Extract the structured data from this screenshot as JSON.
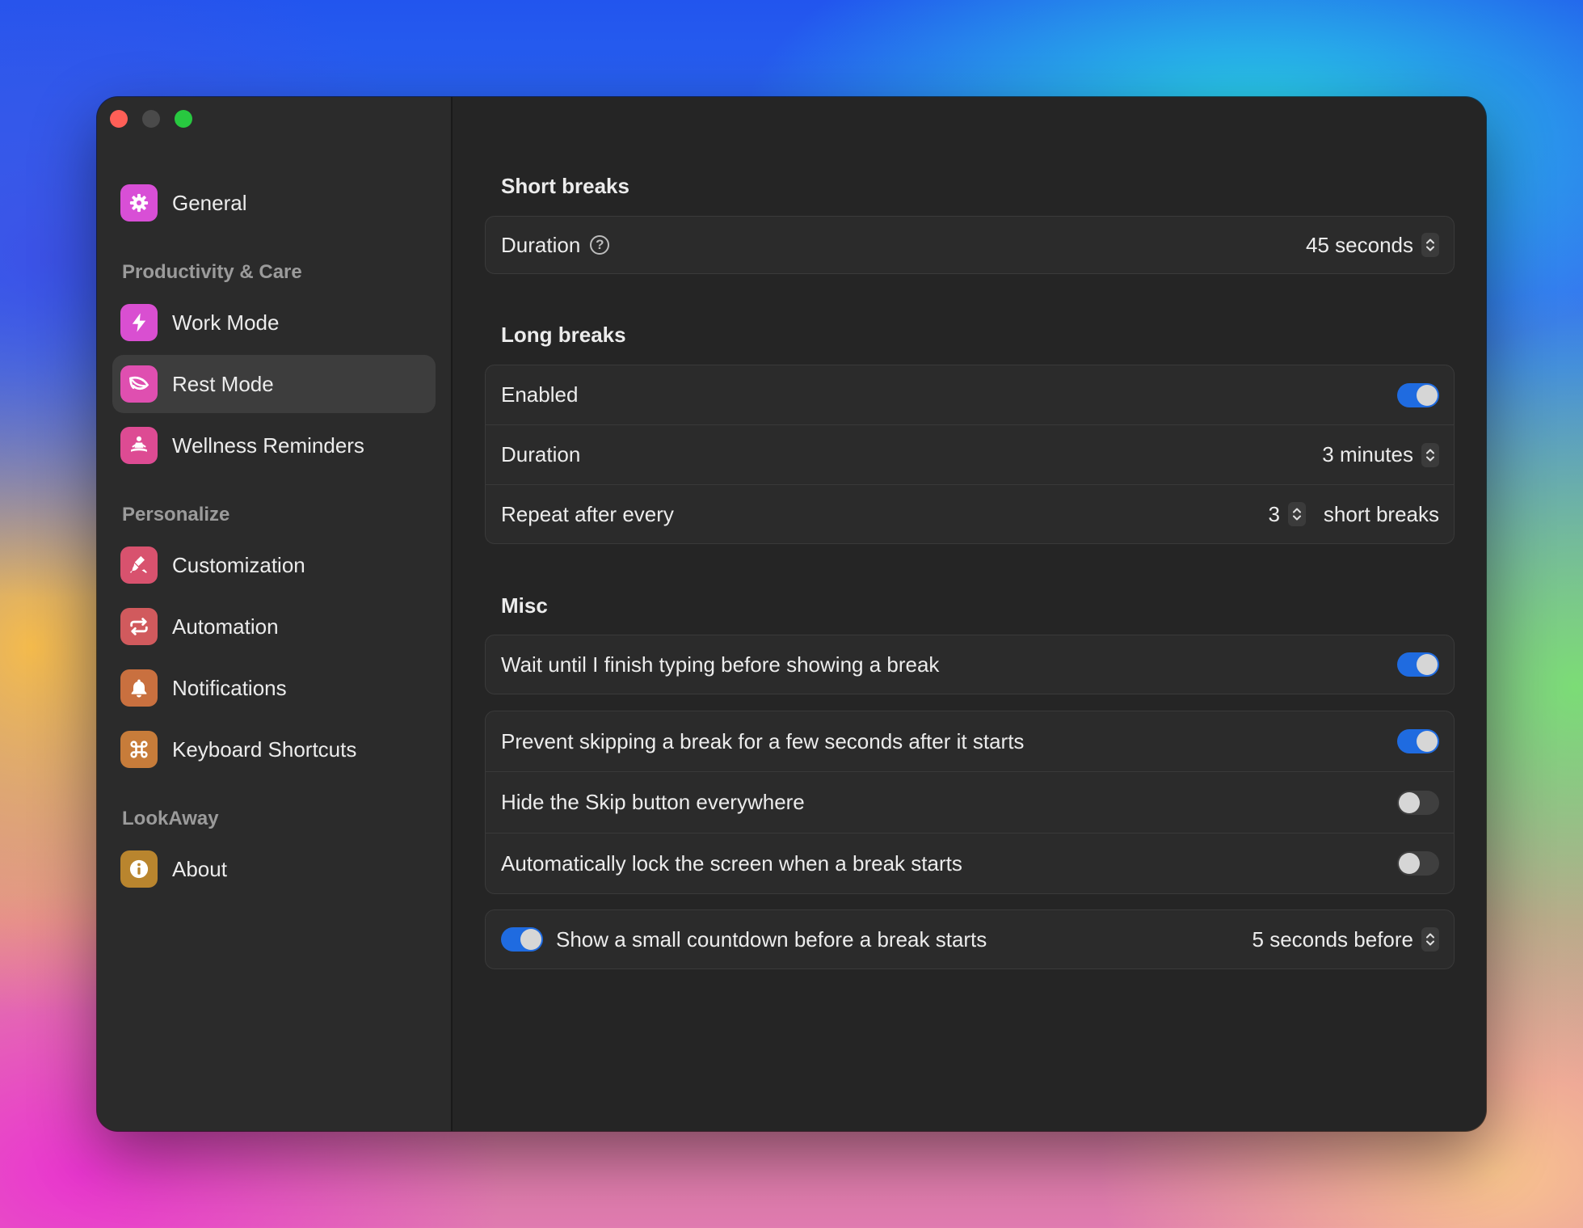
{
  "sidebar": {
    "general": {
      "label": "General",
      "icon": "gear-icon"
    },
    "sections": [
      {
        "heading": "Productivity & Care",
        "items": [
          {
            "label": "Work Mode",
            "icon": "bolt-icon"
          },
          {
            "label": "Rest Mode",
            "icon": "leaf-icon",
            "active": true
          },
          {
            "label": "Wellness Reminders",
            "icon": "meditation-icon"
          }
        ]
      },
      {
        "heading": "Personalize",
        "items": [
          {
            "label": "Customization",
            "icon": "brush-icon"
          },
          {
            "label": "Automation",
            "icon": "repeat-icon"
          },
          {
            "label": "Notifications",
            "icon": "bell-icon"
          },
          {
            "label": "Keyboard Shortcuts",
            "icon": "command-icon"
          }
        ]
      },
      {
        "heading": "LookAway",
        "items": [
          {
            "label": "About",
            "icon": "info-icon"
          }
        ]
      }
    ]
  },
  "short_breaks": {
    "title": "Short breaks",
    "duration_label": "Duration",
    "duration_value": "45 seconds"
  },
  "long_breaks": {
    "title": "Long breaks",
    "enabled_label": "Enabled",
    "enabled": true,
    "duration_label": "Duration",
    "duration_value": "3 minutes",
    "repeat_label": "Repeat after every",
    "repeat_value": "3",
    "repeat_suffix": "short breaks"
  },
  "misc": {
    "title": "Misc",
    "wait_typing_label": "Wait until I finish typing before showing a break",
    "wait_typing": true,
    "prevent_skip_label": "Prevent skipping a break for a few seconds after it starts",
    "prevent_skip": true,
    "hide_skip_label": "Hide the Skip button everywhere",
    "hide_skip": false,
    "auto_lock_label": "Automatically lock the screen when a break starts",
    "auto_lock": false,
    "countdown_label": "Show a small countdown before a break starts",
    "countdown": true,
    "countdown_value": "5 seconds before"
  },
  "colors": {
    "accent": "#1f6be0",
    "gear": "#d84fd6",
    "bolt": "#d94fd1",
    "leaf": "#df4fb0",
    "meditation": "#dd4b93",
    "brush": "#d8526e",
    "repeat": "#d15a5d",
    "bell": "#c9703f",
    "command": "#c77c3a",
    "info": "#b9852e"
  }
}
